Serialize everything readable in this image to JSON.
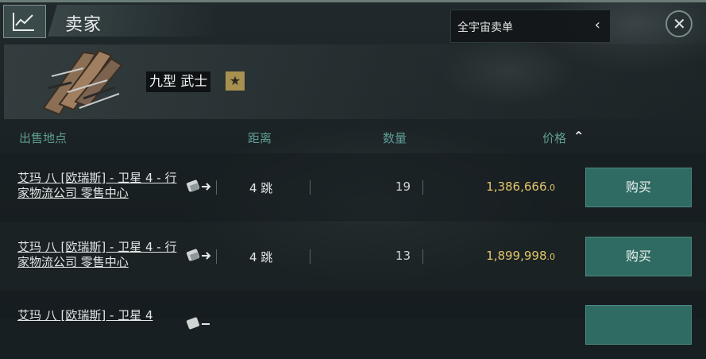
{
  "header": {
    "title": "卖家",
    "scope_select": {
      "value": "全宇宙卖单",
      "chevron": "chevron-left-icon"
    }
  },
  "item": {
    "name": "九型 武士",
    "badge": "★"
  },
  "columns": {
    "location": "出售地点",
    "distance": "距离",
    "quantity": "数量",
    "price": "价格"
  },
  "sort": {
    "column": "价格",
    "direction": "ascending"
  },
  "rows": [
    {
      "location": "艾玛 八 [欧瑞斯] - 卫星 4 - 行家物流公司 零售中心",
      "distance": "4 跳",
      "quantity": "19",
      "price": "1,386,666",
      "price_decimal": ".0",
      "buy_label": "购买"
    },
    {
      "location": "艾玛 八 [欧瑞斯] - 卫星 4 - 行家物流公司 零售中心",
      "distance": "4 跳",
      "quantity": "13",
      "price": "1,899,998",
      "price_decimal": ".0",
      "buy_label": "购买"
    },
    {
      "location": "艾玛 八 [欧瑞斯] - 卫星 4",
      "distance": "",
      "quantity": "",
      "price": "",
      "price_decimal": "",
      "buy_label": ""
    }
  ],
  "colors": {
    "accent": "#2f6b62",
    "price": "#e5c56a",
    "header_text": "#5f9c93"
  }
}
